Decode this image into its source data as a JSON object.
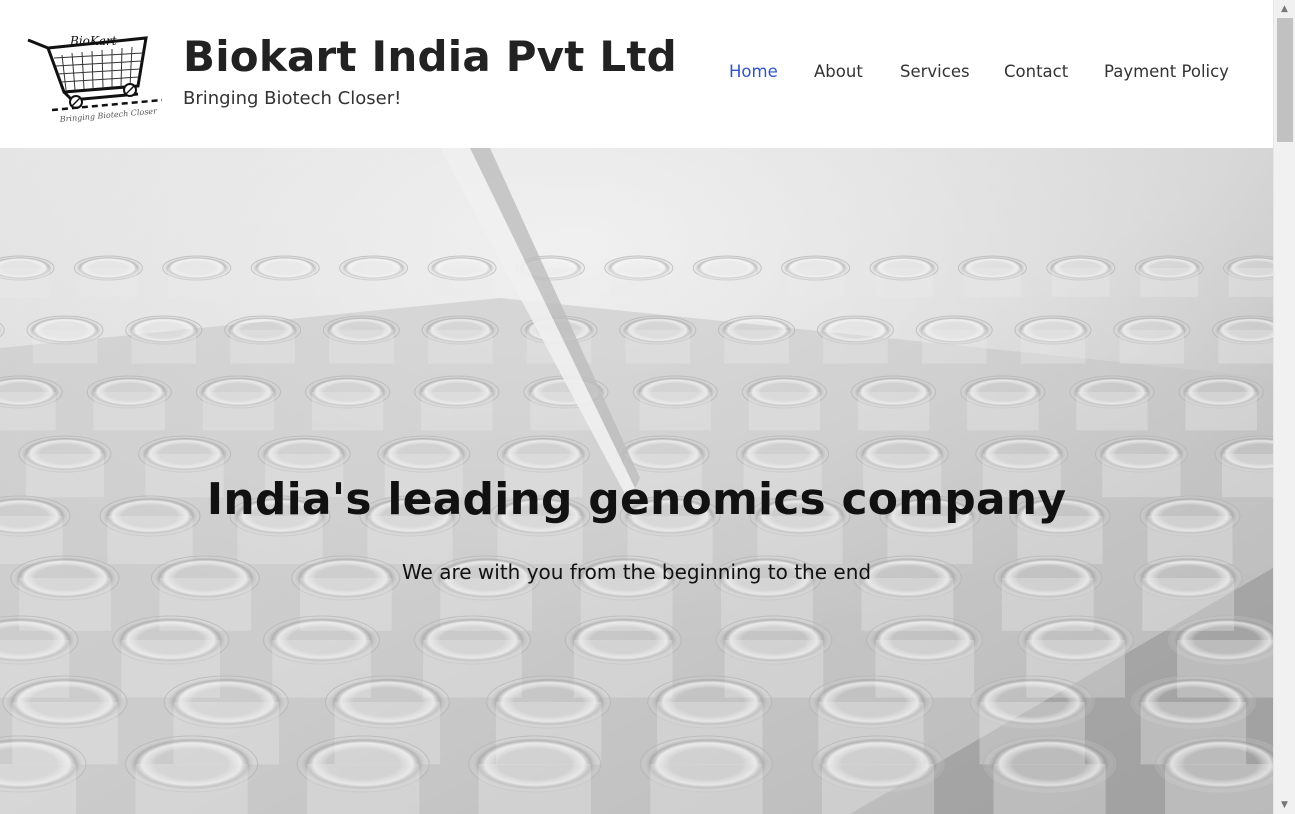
{
  "header": {
    "logo": {
      "text": "BioKart",
      "slogan": "Bringing Biotech Closer"
    },
    "title": "Biokart India Pvt Ltd",
    "tagline": "Bringing Biotech Closer!",
    "nav": [
      {
        "label": "Home",
        "active": true
      },
      {
        "label": "About",
        "active": false
      },
      {
        "label": "Services",
        "active": false
      },
      {
        "label": "Contact",
        "active": false
      },
      {
        "label": "Payment Policy",
        "active": false
      }
    ]
  },
  "hero": {
    "title": "India's leading genomics company",
    "subtitle": "We are with you from the beginning to the end",
    "background": "grayscale photo of pipette over tube rack"
  },
  "colors": {
    "accent": "#2f56c6",
    "text": "#222222",
    "header_bg": "#ffffff"
  },
  "scrollbar": {
    "up_icon": "triangle-up-icon",
    "down_icon": "triangle-down-icon"
  }
}
